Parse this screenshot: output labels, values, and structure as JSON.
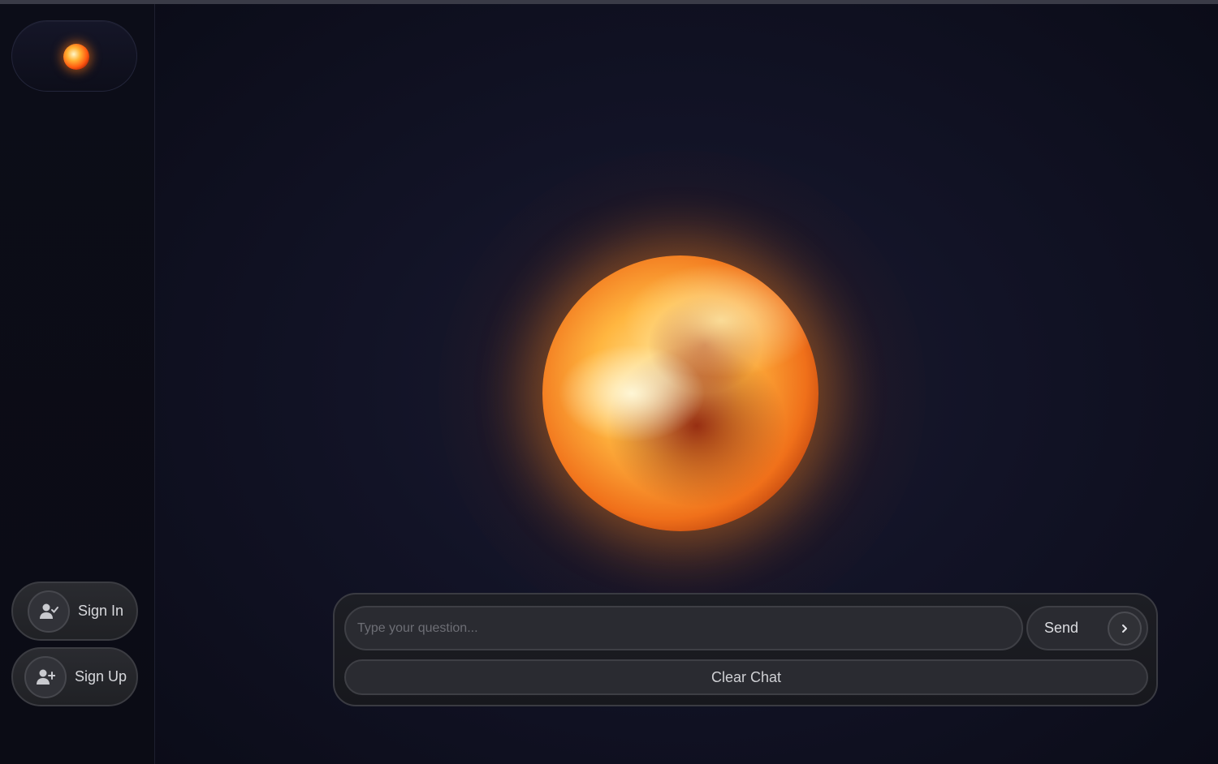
{
  "sidebar": {
    "logo_icon": "fire-orb-logo",
    "auth": [
      {
        "label": "Sign In",
        "icon": "user-check-icon"
      },
      {
        "label": "Sign Up",
        "icon": "user-plus-icon"
      }
    ]
  },
  "main": {
    "visual": "glowing-fire-sphere"
  },
  "chat": {
    "input_placeholder": "Type your question...",
    "input_value": "",
    "send_label": "Send",
    "send_icon": "chevron-right-icon",
    "clear_label": "Clear Chat"
  },
  "colors": {
    "background": "#0b0c16",
    "panel": "#1d1e24",
    "control": "#2a2b31",
    "border": "#3e3f45",
    "fire_core": "#ffb640",
    "fire_edge": "#9b2306"
  }
}
